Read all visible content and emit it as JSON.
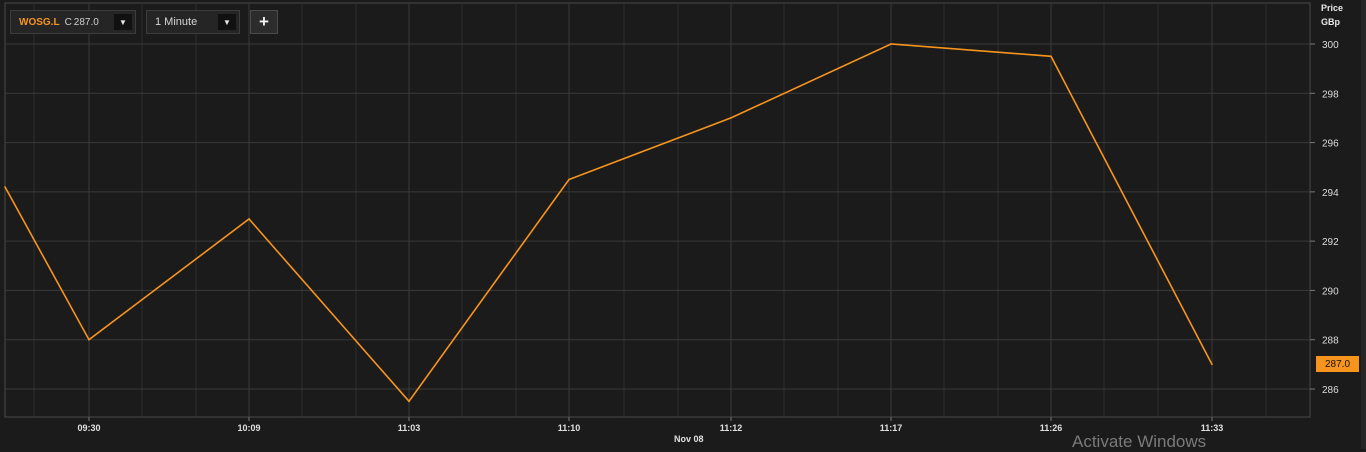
{
  "toolbar": {
    "ric_code": "WOSG.L",
    "close_label": "C",
    "close_value": "287.0",
    "ric_dropdown_icon": "▼",
    "interval_label": "1 Minute",
    "interval_dropdown_icon": "▼",
    "add_button_label": "+"
  },
  "axis": {
    "price_title": "Price",
    "currency_title": "GBp",
    "date_label": "Nov 08"
  },
  "last_price_badge": "287.0",
  "watermark": "Activate Windows",
  "colors": {
    "background": "#1b1b1b",
    "grid": "#3a3a3a",
    "line": "#f7941d",
    "badge": "#f7941d"
  },
  "chart_data": {
    "type": "line",
    "x": [
      "",
      "09:30",
      "10:09",
      "11:03",
      "11:10",
      "11:12",
      "11:17",
      "11:26",
      "11:33"
    ],
    "series": [
      {
        "values": [
          294.2,
          288.0,
          292.9,
          285.5,
          294.5,
          297.0,
          300.0,
          299.5,
          287.0
        ]
      }
    ],
    "tick_labels_x": [
      "09:30",
      "10:09",
      "11:03",
      "11:10",
      "11:12",
      "11:17",
      "11:26",
      "11:33"
    ],
    "y_ticks": [
      286,
      288,
      290,
      292,
      294,
      296,
      298,
      300
    ],
    "ylim": [
      285,
      301
    ],
    "grid": true,
    "last_value": 287.0
  }
}
